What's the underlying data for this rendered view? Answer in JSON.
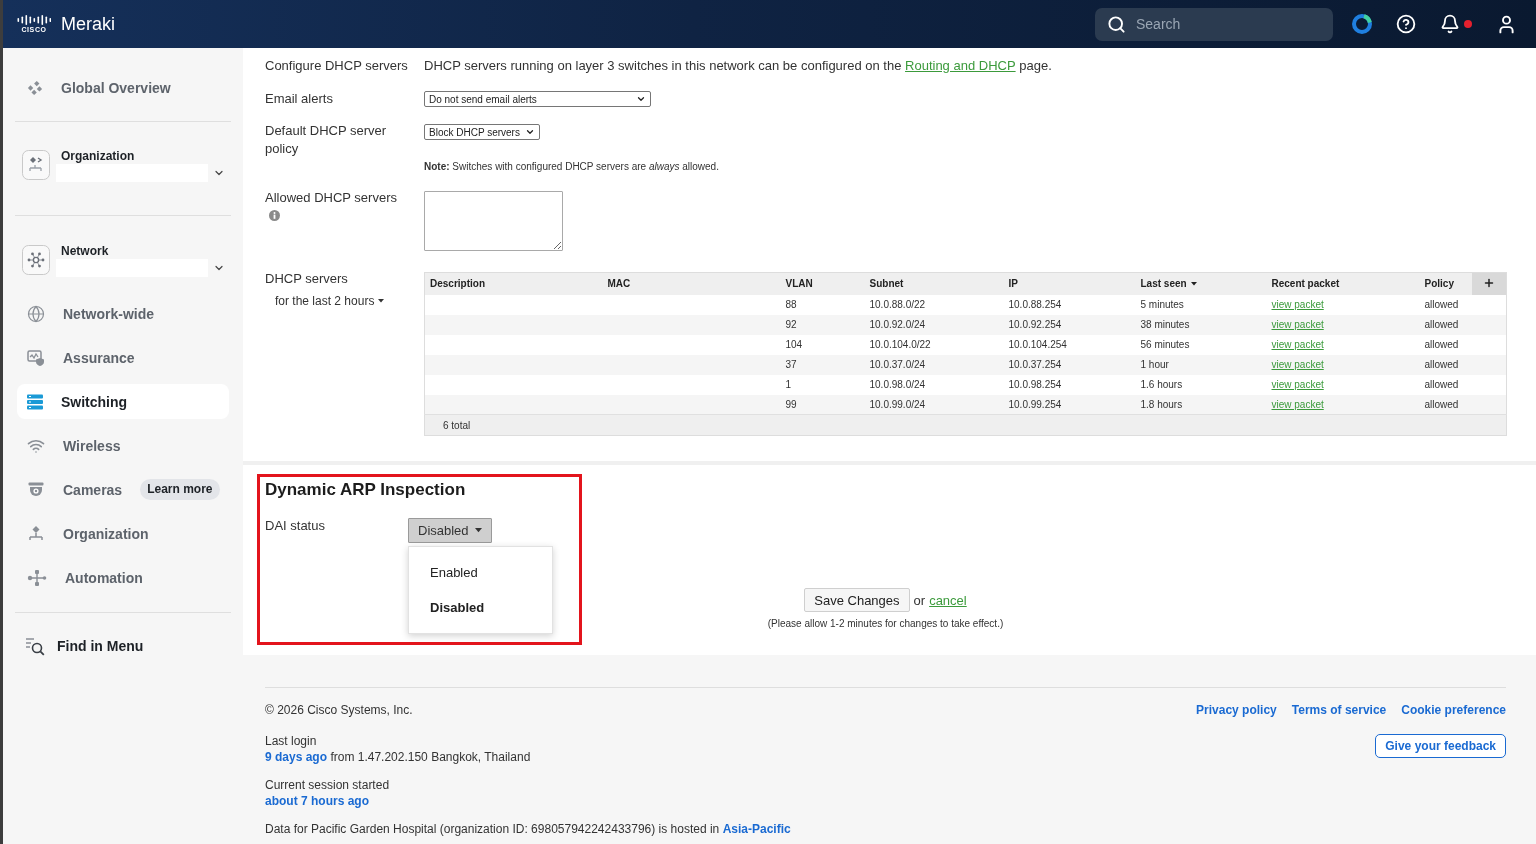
{
  "header": {
    "logo_text": "CISCO",
    "brand": "Meraki",
    "search": {
      "placeholder": "Search"
    },
    "notifications": {
      "unread": true
    }
  },
  "sidebar": {
    "overview": {
      "label": "Global Overview",
      "selected": false
    },
    "pickers": [
      {
        "label": "Organization"
      },
      {
        "label": "Network"
      }
    ],
    "items": [
      {
        "label": "Network-wide",
        "selected": false
      },
      {
        "label": "Assurance",
        "selected": false
      },
      {
        "label": "Switching",
        "selected": true
      },
      {
        "label": "Wireless",
        "selected": false
      },
      {
        "label": "Cameras",
        "selected": false,
        "badge": "Learn more"
      },
      {
        "label": "Organization",
        "selected": false
      },
      {
        "label": "Automation",
        "selected": false
      }
    ],
    "find": {
      "label": "Find in Menu"
    }
  },
  "dhcp": {
    "configure": {
      "label": "Configure DHCP servers",
      "text": "DHCP servers running on layer 3 switches in this network can be configured on the",
      "link": "Routing and DHCP",
      "text_after": "page."
    },
    "email_alerts": {
      "label": "Email alerts",
      "value": "Do not send email alerts"
    },
    "default_policy": {
      "label": "Default DHCP server policy",
      "value": "Block DHCP servers",
      "note": "**Note:** Switches with configured DHCP servers are *always* allowed."
    },
    "allowed_servers": {
      "label": "Allowed DHCP servers"
    },
    "servers": {
      "label": "DHCP servers",
      "period": "for the last 2 hours"
    },
    "table": {
      "columns": [
        {
          "label": "Description",
          "sorted": false
        },
        {
          "label": "MAC",
          "sorted": false
        },
        {
          "label": "VLAN",
          "sorted": false
        },
        {
          "label": "Subnet",
          "sorted": false
        },
        {
          "label": "IP",
          "sorted": false
        },
        {
          "label": "Last seen",
          "sorted": true
        },
        {
          "label": "Recent packet",
          "sorted": false
        },
        {
          "label": "Policy",
          "sorted": false
        }
      ],
      "rows": [
        {
          "vlan": "88",
          "subnet": "10.0.88.0/22",
          "ip": "10.0.88.254",
          "last_seen": "5 minutes",
          "recent_packet": "view packet",
          "policy": "allowed"
        },
        {
          "vlan": "92",
          "subnet": "10.0.92.0/24",
          "ip": "10.0.92.254",
          "last_seen": "38 minutes",
          "recent_packet": "view packet",
          "policy": "allowed"
        },
        {
          "vlan": "104",
          "subnet": "10.0.104.0/22",
          "ip": "10.0.104.254",
          "last_seen": "56 minutes",
          "recent_packet": "view packet",
          "policy": "allowed"
        },
        {
          "vlan": "37",
          "subnet": "10.0.37.0/24",
          "ip": "10.0.37.254",
          "last_seen": "1 hour",
          "recent_packet": "view packet",
          "policy": "allowed"
        },
        {
          "vlan": "1",
          "subnet": "10.0.98.0/24",
          "ip": "10.0.98.254",
          "last_seen": "1.6 hours",
          "recent_packet": "view packet",
          "policy": "allowed"
        },
        {
          "vlan": "99",
          "subnet": "10.0.99.0/24",
          "ip": "10.0.99.254",
          "last_seen": "1.8 hours",
          "recent_packet": "view packet",
          "policy": "allowed"
        }
      ],
      "total": "6 total"
    }
  },
  "dai": {
    "title": "Dynamic ARP Inspection",
    "status_label": "DAI status",
    "value": "Disabled",
    "expanded": true,
    "options": [
      {
        "label": "Enabled",
        "selected": false
      },
      {
        "label": "Disabled",
        "selected": true
      }
    ]
  },
  "actions": {
    "save": "Save Changes",
    "or": "or",
    "cancel": "cancel",
    "hint": "(Please allow 1-2 minutes for changes to take effect.)"
  },
  "footer": {
    "copyright": "© 2026 Cisco Systems, Inc.",
    "links": [
      "Privacy policy",
      "Terms of service",
      "Cookie preference"
    ],
    "feedback": "Give your feedback",
    "last_login": {
      "label": "Last login",
      "link": "9 days ago",
      "text": "from 1.47.202.150 Bangkok, Thailand"
    },
    "session": {
      "label": "Current session started",
      "link": "about 7 hours ago"
    },
    "hosting": {
      "text": "Data for Pacific Garden Hospital (organization ID: 698057942242433796) is hosted in",
      "link": "Asia-Pacific"
    }
  }
}
